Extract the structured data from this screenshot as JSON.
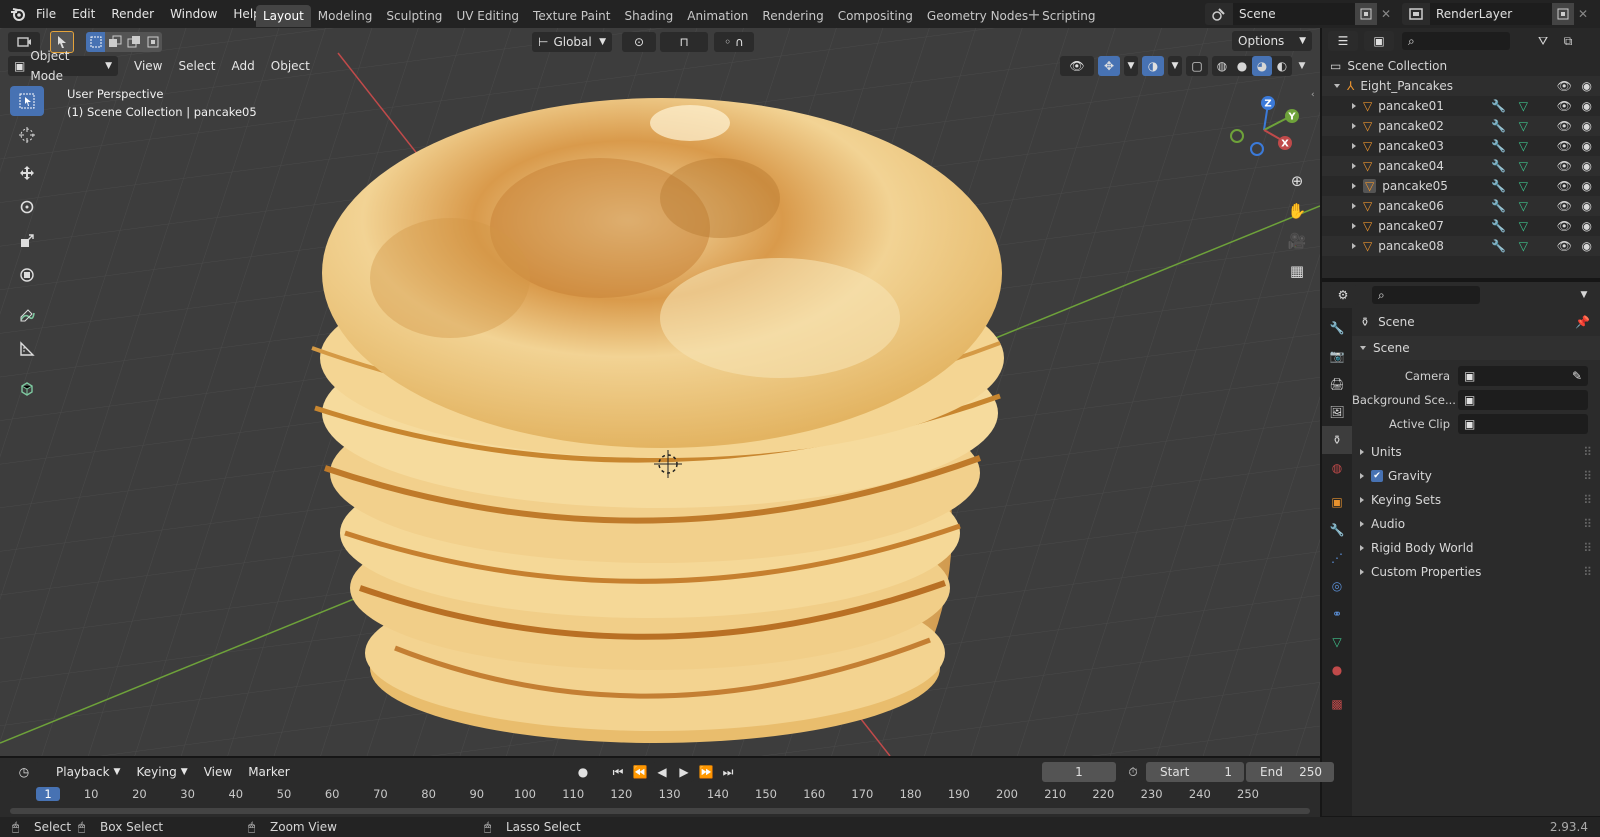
{
  "menu": [
    "File",
    "Edit",
    "Render",
    "Window",
    "Help"
  ],
  "workspaces": [
    "Layout",
    "Modeling",
    "Sculpting",
    "UV Editing",
    "Texture Paint",
    "Shading",
    "Animation",
    "Rendering",
    "Compositing",
    "Geometry Nodes",
    "Scripting"
  ],
  "active_workspace": "Layout",
  "scene_name": "Scene",
  "view_layer": "RenderLayer",
  "viewport": {
    "transform_orientation": "Global",
    "options_label": "Options",
    "mode": "Object Mode",
    "header_menus": [
      "View",
      "Select",
      "Add",
      "Object"
    ],
    "overlay_line1": "User Perspective",
    "overlay_line2": "(1) Scene Collection | pancake05",
    "gizmo_axes": {
      "x": "X",
      "y": "Y",
      "z": "Z"
    }
  },
  "outliner": {
    "root": "Scene Collection",
    "collection": "Eight_Pancakes",
    "objects": [
      "pancake01",
      "pancake02",
      "pancake03",
      "pancake04",
      "pancake05",
      "pancake06",
      "pancake07",
      "pancake08"
    ],
    "active_object": "pancake05"
  },
  "properties": {
    "context": "Scene",
    "panel": "Scene",
    "fields": [
      {
        "label": "Camera",
        "value": ""
      },
      {
        "label": "Background Sce...",
        "value": ""
      },
      {
        "label": "Active Clip",
        "value": ""
      }
    ],
    "subpanels": [
      "Units",
      "Gravity",
      "Keying Sets",
      "Audio",
      "Rigid Body World",
      "Custom Properties"
    ],
    "gravity_checked": true
  },
  "timeline": {
    "menus": [
      "Playback",
      "Keying",
      "View",
      "Marker"
    ],
    "current_frame": "1",
    "start_label": "Start",
    "start": "1",
    "end_label": "End",
    "end": "250",
    "ruler": [
      "1",
      "10",
      "20",
      "30",
      "40",
      "50",
      "60",
      "70",
      "80",
      "90",
      "100",
      "110",
      "120",
      "130",
      "140",
      "150",
      "160",
      "170",
      "180",
      "190",
      "200",
      "210",
      "220",
      "230",
      "240",
      "250"
    ]
  },
  "status": {
    "select": "Select",
    "box_select": "Box Select",
    "zoom_view": "Zoom View",
    "lasso_select": "Lasso Select",
    "version": "2.93.4"
  },
  "colors": {
    "accent": "#4772b3",
    "pancake_light": "#f4d18a",
    "pancake_brown": "#c98a3a",
    "axis_x": "#c04a4a",
    "axis_y": "#6ea23a",
    "object_orange": "#e8922e",
    "mesh_green": "#3fc08a"
  }
}
